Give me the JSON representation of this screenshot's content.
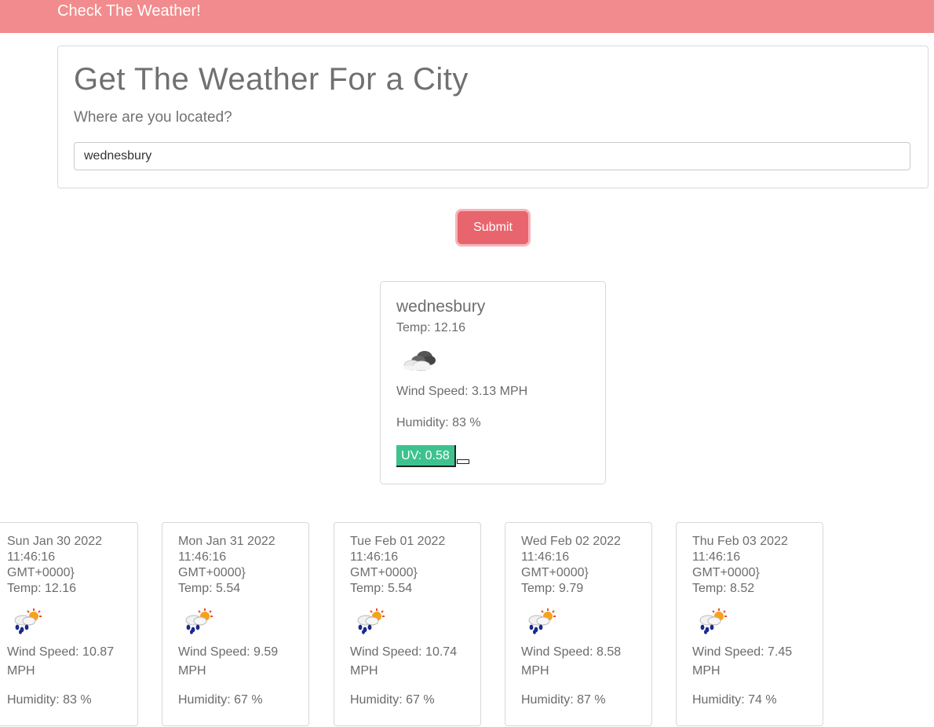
{
  "header": {
    "brand": "Check The Weather!",
    "color": "#f28b8d"
  },
  "search": {
    "title": "Get The Weather For a City",
    "subtitle": "Where are you located?",
    "input_value": "wednesbury",
    "submit_label": "Submit"
  },
  "current": {
    "city": "wednesbury",
    "temp": "Temp: 12.16",
    "icon": "cloudy-icon",
    "wind": "Wind Speed: 3.13 MPH",
    "humidity": "Humidity: 83 %",
    "uv": "UV: 0.58",
    "uv_color": "#3dc28e"
  },
  "forecast": [
    {
      "date": "Sun Jan 30 2022 11:46:16 GMT+0000}",
      "temp": "Temp: 12.16",
      "icon": "rain-sun-icon",
      "wind": "Wind Speed: 10.87 MPH",
      "humidity": "Humidity: 83 %"
    },
    {
      "date": "Mon Jan 31 2022 11:46:16 GMT+0000}",
      "temp": "Temp: 5.54",
      "icon": "rain-sun-icon",
      "wind": "Wind Speed: 9.59 MPH",
      "humidity": "Humidity: 67 %"
    },
    {
      "date": "Tue Feb 01 2022 11:46:16 GMT+0000}",
      "temp": "Temp: 5.54",
      "icon": "rain-sun-icon",
      "wind": "Wind Speed: 10.74 MPH",
      "humidity": "Humidity: 67 %"
    },
    {
      "date": "Wed Feb 02 2022 11:46:16 GMT+0000}",
      "temp": "Temp: 9.79",
      "icon": "rain-sun-icon",
      "wind": "Wind Speed: 8.58 MPH",
      "humidity": "Humidity: 87 %"
    },
    {
      "date": "Thu Feb 03 2022 11:46:16 GMT+0000}",
      "temp": "Temp: 8.52",
      "icon": "rain-sun-icon",
      "wind": "Wind Speed: 7.45 MPH",
      "humidity": "Humidity: 74 %"
    }
  ]
}
